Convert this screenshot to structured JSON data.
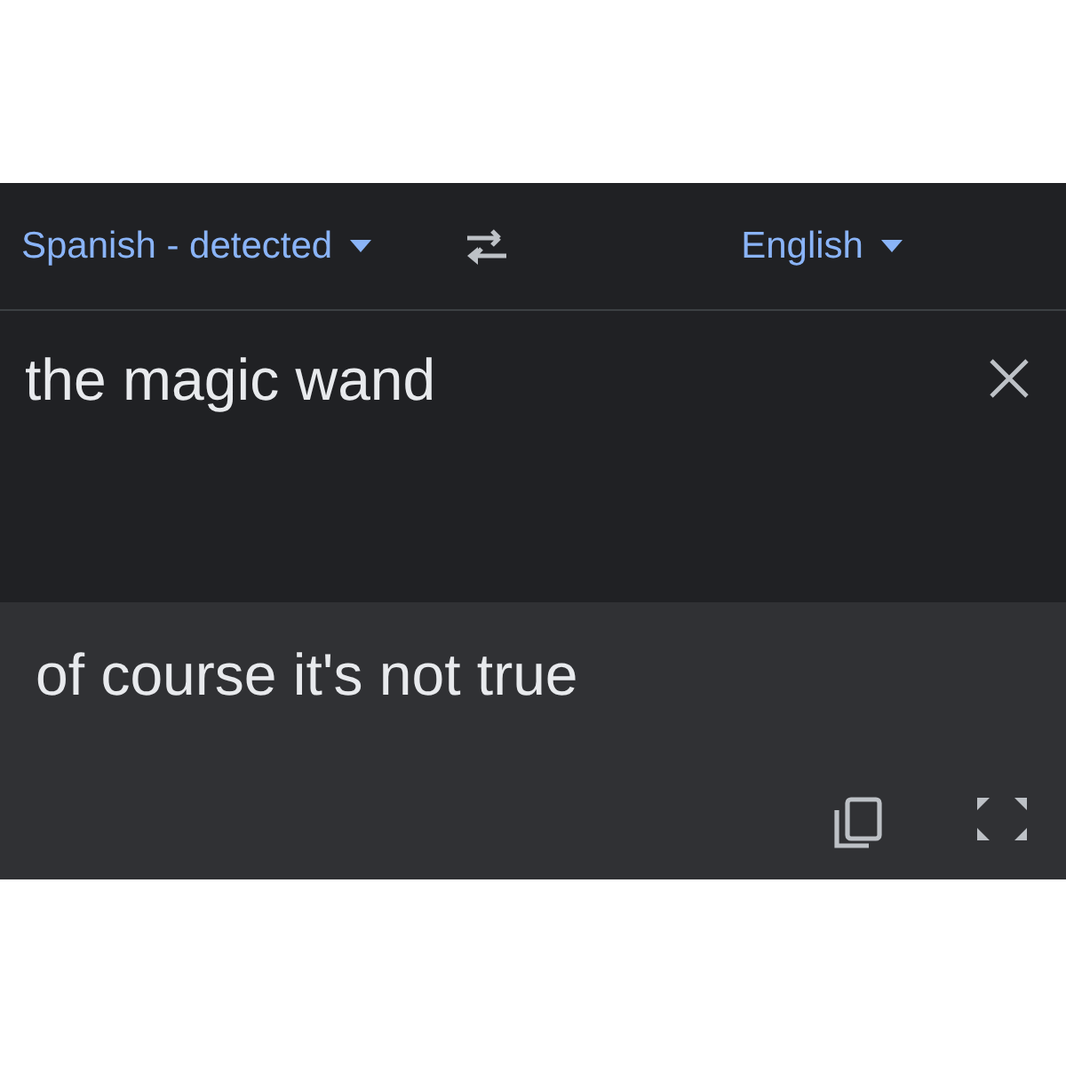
{
  "language_bar": {
    "source": "Spanish - detected",
    "target": "English"
  },
  "input": {
    "value": "the magic wand"
  },
  "output": {
    "text": "of course it's not true"
  }
}
